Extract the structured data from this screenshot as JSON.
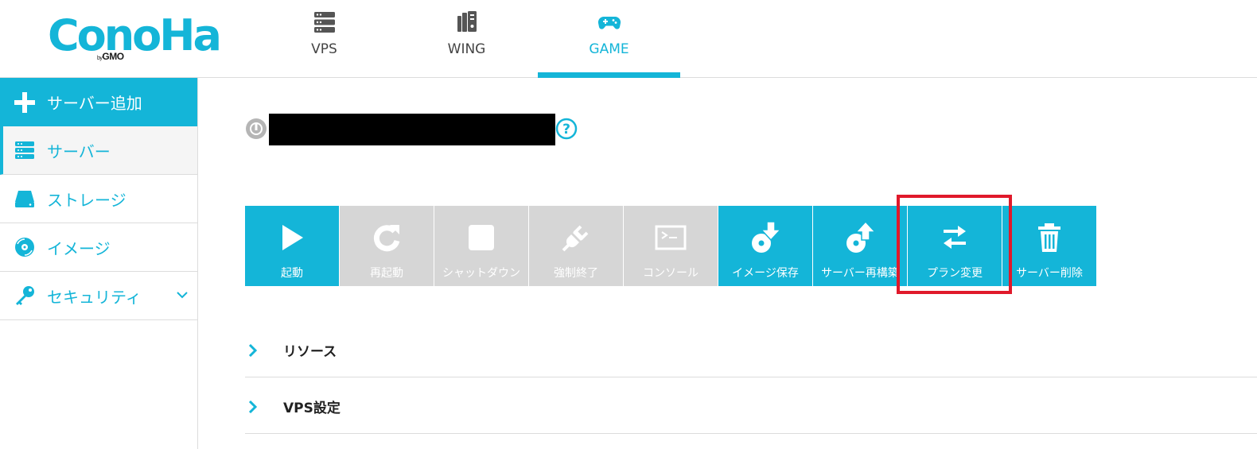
{
  "brand": {
    "logo_text": "ConoHa",
    "logo_sub_by": "by",
    "logo_sub_name": "GMO",
    "accent_color": "#14b5d8",
    "highlight_color": "#e0192b"
  },
  "topnav": {
    "tabs": [
      {
        "label": "VPS",
        "icon": "server-rack-icon",
        "active": false
      },
      {
        "label": "WING",
        "icon": "wing-icon",
        "active": false
      },
      {
        "label": "GAME",
        "icon": "gamepad-icon",
        "active": true
      }
    ]
  },
  "sidebar": {
    "add_label": "サーバー追加",
    "items": [
      {
        "label": "サーバー",
        "icon": "server-icon",
        "active": true
      },
      {
        "label": "ストレージ",
        "icon": "storage-icon",
        "active": false
      },
      {
        "label": "イメージ",
        "icon": "disc-icon",
        "active": false
      },
      {
        "label": "セキュリティ",
        "icon": "key-icon",
        "active": false,
        "expandable": true
      }
    ]
  },
  "server": {
    "name": "",
    "status_icon": "power-icon",
    "help_icon": "help-icon"
  },
  "actions": [
    {
      "label": "起動",
      "icon": "play-icon",
      "enabled": true
    },
    {
      "label": "再起動",
      "icon": "restart-icon",
      "enabled": false
    },
    {
      "label": "シャットダウン",
      "icon": "stop-icon",
      "enabled": false
    },
    {
      "label": "強制終了",
      "icon": "plug-icon",
      "enabled": false
    },
    {
      "label": "コンソール",
      "icon": "console-icon",
      "enabled": false
    },
    {
      "label": "イメージ保存",
      "icon": "image-save-icon",
      "enabled": true
    },
    {
      "label": "サーバー再構築",
      "icon": "rebuild-icon",
      "enabled": true
    },
    {
      "label": "プラン変更",
      "icon": "swap-arrows-icon",
      "enabled": true,
      "highlighted": true
    },
    {
      "label": "サーバー削除",
      "icon": "trash-icon",
      "enabled": true
    }
  ],
  "sections": [
    {
      "title": "リソース"
    },
    {
      "title": "VPS設定"
    }
  ]
}
